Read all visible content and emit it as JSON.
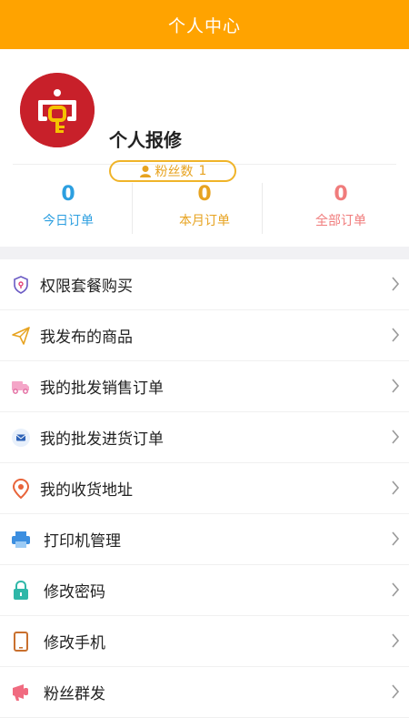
{
  "header": {
    "title": "个人中心"
  },
  "profile": {
    "name": "个人报修",
    "fans_label": "粉丝数",
    "fans_count": "1"
  },
  "stats": [
    {
      "value": "0",
      "label": "今日订单",
      "color": "#2C9FE0"
    },
    {
      "value": "0",
      "label": "本月订单",
      "color": "#E7A320"
    },
    {
      "value": "0",
      "label": "全部订单",
      "color": "#F07C7C"
    }
  ],
  "menu": [
    {
      "label": "权限套餐购买",
      "icon": "shield-icon"
    },
    {
      "label": "我发布的商品",
      "icon": "paper-plane-icon"
    },
    {
      "label": "我的批发销售订单",
      "icon": "truck-icon"
    },
    {
      "label": "我的批发进货订单",
      "icon": "envelope-icon"
    },
    {
      "label": "我的收货地址",
      "icon": "location-pin-icon"
    },
    {
      "label": "打印机管理",
      "icon": "printer-icon"
    },
    {
      "label": "修改密码",
      "icon": "lock-icon"
    },
    {
      "label": "修改手机",
      "icon": "phone-icon"
    },
    {
      "label": "粉丝群发",
      "icon": "megaphone-icon"
    }
  ],
  "colors": {
    "header": "#FFA300",
    "avatar_bg": "#C8202A",
    "badge": "#F0B429"
  }
}
